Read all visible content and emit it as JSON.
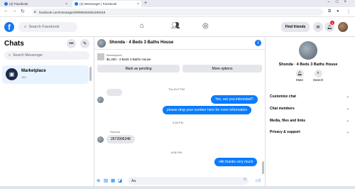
{
  "browser": {
    "tabs": [
      {
        "label": "(2) Facebook"
      },
      {
        "label": "(2) Messenger | Facebook"
      }
    ],
    "new_tab": "+",
    "url": "facebook.com/messages/t/9055346361159419"
  },
  "header": {
    "logo": "f",
    "search_placeholder": "Search Facebook",
    "find_friends": "Find friends",
    "notif_count": "3"
  },
  "sidebar": {
    "title": "Chats",
    "search_placeholder": "Search Messenger",
    "items": [
      {
        "name": "Marketplace",
        "time": "14h"
      }
    ]
  },
  "conversation": {
    "title": "Shonda · 4 Beds 3 Baths House",
    "listing": {
      "label": "Marketplace",
      "price_title": "$1,400 - 4 Beds 3 Baths House"
    },
    "mark_pending": "Mark as pending",
    "more_options": "More options",
    "timestamps": [
      "Thu 8:07 PM",
      "3:48 PM",
      "8:56 PM"
    ],
    "messages_out": [
      "Yes, are you interested?",
      "please drop your number here for more information",
      "okk thanks very much"
    ],
    "sender_name": "Shonda",
    "message_in": "2672906248",
    "composer_value": "Aa"
  },
  "info": {
    "name": "Shonda · 4 Beds 3 Baths House",
    "actions": [
      {
        "label": "Mute"
      },
      {
        "label": "Search"
      }
    ],
    "rows": [
      {
        "label": "Customize chat"
      },
      {
        "label": "Chat members"
      },
      {
        "label": "Media, files and links"
      },
      {
        "label": "Privacy & support"
      }
    ]
  },
  "colors": {
    "accent": "#0a7cff",
    "brand": "#1877f2",
    "selected": "#e7f3ff"
  }
}
